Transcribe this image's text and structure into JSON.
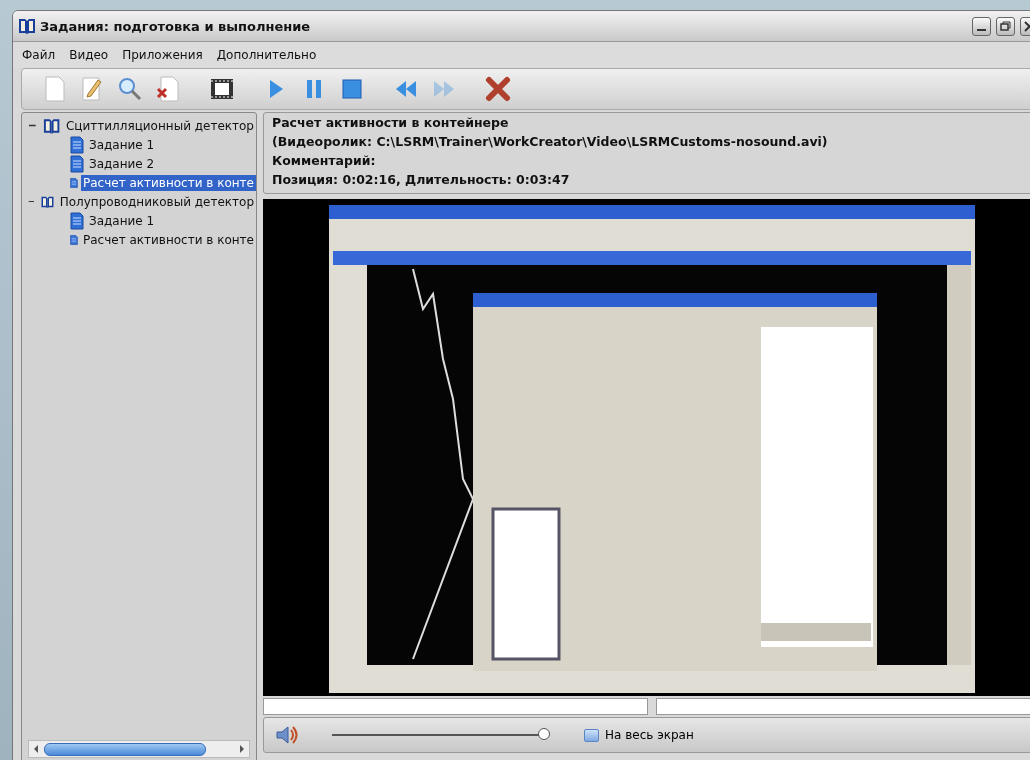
{
  "window": {
    "title": "Задания: подготовка и выполнение"
  },
  "menu": [
    "Файл",
    "Видео",
    "Приложения",
    "Дополнительно"
  ],
  "toolbar": [
    {
      "disabled": false
    },
    {
      "disabled": false
    },
    {
      "disabled": false
    },
    {
      "disabled": false
    },
    {
      "disabled": false
    },
    {
      "disabled": false
    },
    {
      "disabled": false
    },
    {
      "disabled": false
    },
    {
      "disabled": false
    },
    {
      "disabled": true
    },
    {
      "disabled": false
    }
  ],
  "tree": [
    {
      "label": "Сциттилляционный детектор",
      "expanded": true,
      "children": [
        {
          "label": "Задание 1",
          "selected": false
        },
        {
          "label": "Задание 2",
          "selected": false
        },
        {
          "label": "Расчет активности в конте",
          "selected": true
        }
      ]
    },
    {
      "label": "Полупроводниковый детектор",
      "expanded": true,
      "children": [
        {
          "label": "Задание 1",
          "selected": false
        },
        {
          "label": "Расчет активности в конте",
          "selected": false
        }
      ]
    }
  ],
  "info": [
    "Расчет активности в контейнере",
    "(Видеоролик: C:\\LSRM\\Trainer\\WorkCreator\\Video\\LSRMCustoms-nosound.avi)",
    "Комментарий:",
    "Позиция: 0:02:16, Длительность: 0:03:47"
  ],
  "player": {
    "volume": {
      "level": 1.0
    },
    "fullscreen": {
      "label": "На весь экран",
      "checked": false
    }
  }
}
